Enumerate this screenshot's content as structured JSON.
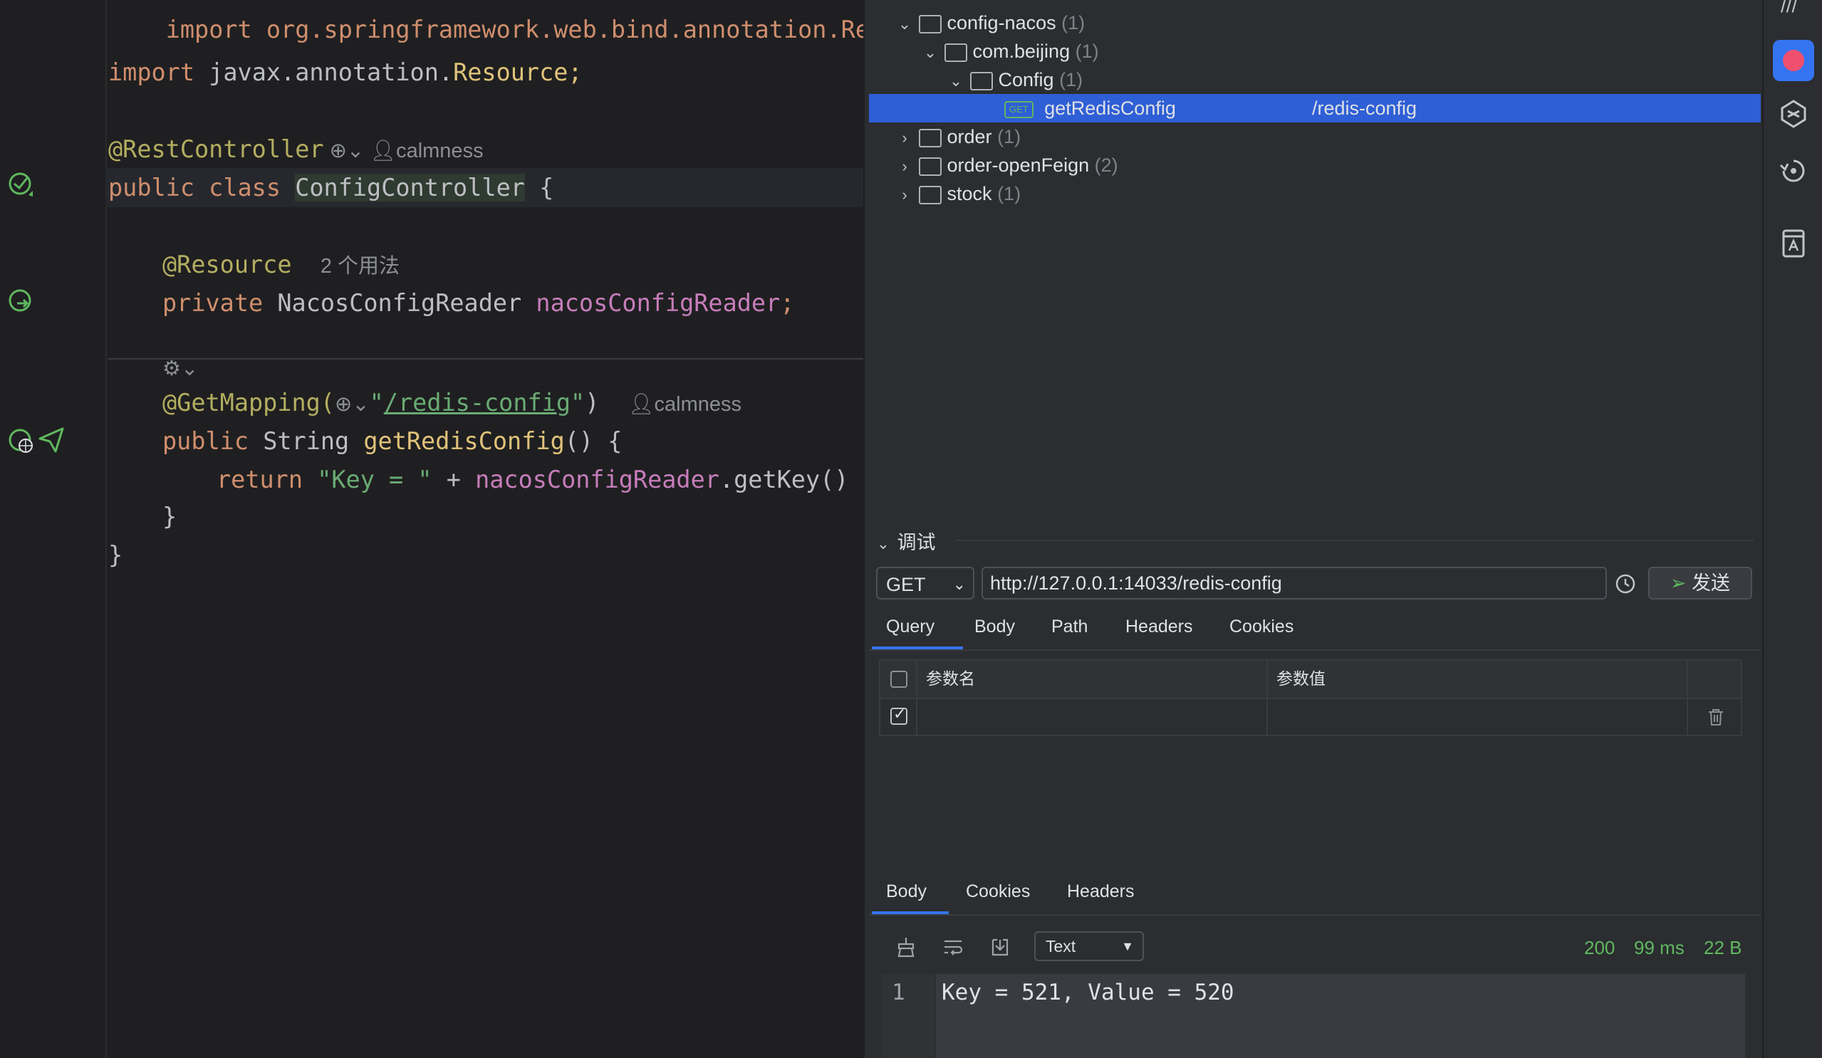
{
  "editor": {
    "lines": {
      "l0": "import org.springframework.web.bind.annotation.RestCont",
      "l1_kw": "import",
      "l1_rest": " javax.annotation.",
      "l1_cls": "Resource",
      "l1_end": ";",
      "l2_ann": "@RestController",
      "l2_author": "calmness",
      "l3_kw": "public class ",
      "l3_cls": "ConfigController",
      "l3_end": " {",
      "l4_ann": "@Resource",
      "l4_hint": "2 个用法",
      "l5_kw": "private ",
      "l5_type": "NacosConfigReader ",
      "l5_field": "nacosConfigReader",
      "l5_end": ";",
      "l6_ann": "@GetMapping(",
      "l6_str_open": "\"",
      "l6_path": "/redis-config",
      "l6_str_close": "\"",
      "l6_end": ")",
      "l6_author": "calmness",
      "l7_kw": "public ",
      "l7_type": "String ",
      "l7_fn": "getRedisConfig",
      "l7_end": "() {",
      "l8_kw": "return ",
      "l8_str": "\"Key = \"",
      "l8_op": " + ",
      "l8_field": "nacosConfigReader",
      "l8_call": ".getKey() +",
      "l9": "}",
      "l10": "}"
    }
  },
  "tree": {
    "items": [
      {
        "name": "config-nacos",
        "count": "(1)"
      },
      {
        "name": "com.beijing",
        "count": "(1)"
      },
      {
        "name": "Config",
        "count": "(1)"
      },
      {
        "name": "getRedisConfig",
        "path": "/redis-config",
        "method": "GET"
      },
      {
        "name": "order",
        "count": "(1)"
      },
      {
        "name": "order-openFeign",
        "count": "(2)"
      },
      {
        "name": "stock",
        "count": "(1)"
      }
    ]
  },
  "debug": {
    "title": "调试",
    "method": "GET",
    "url": "http://127.0.0.1:14033/redis-config",
    "send_label": "发送",
    "request_tabs": [
      "Query",
      "Body",
      "Path",
      "Headers",
      "Cookies"
    ],
    "table_headers": [
      "参数名",
      "参数值"
    ],
    "response_tabs": [
      "Body",
      "Cookies",
      "Headers"
    ],
    "format": "Text",
    "status_code": "200",
    "time": "99 ms",
    "size": "22 B",
    "response_line_number": "1",
    "response_body": "Key = 521, Value = 520"
  },
  "colors": {
    "accent": "#3574f0",
    "selection": "#2e5fd6",
    "success": "#5fb85f"
  }
}
